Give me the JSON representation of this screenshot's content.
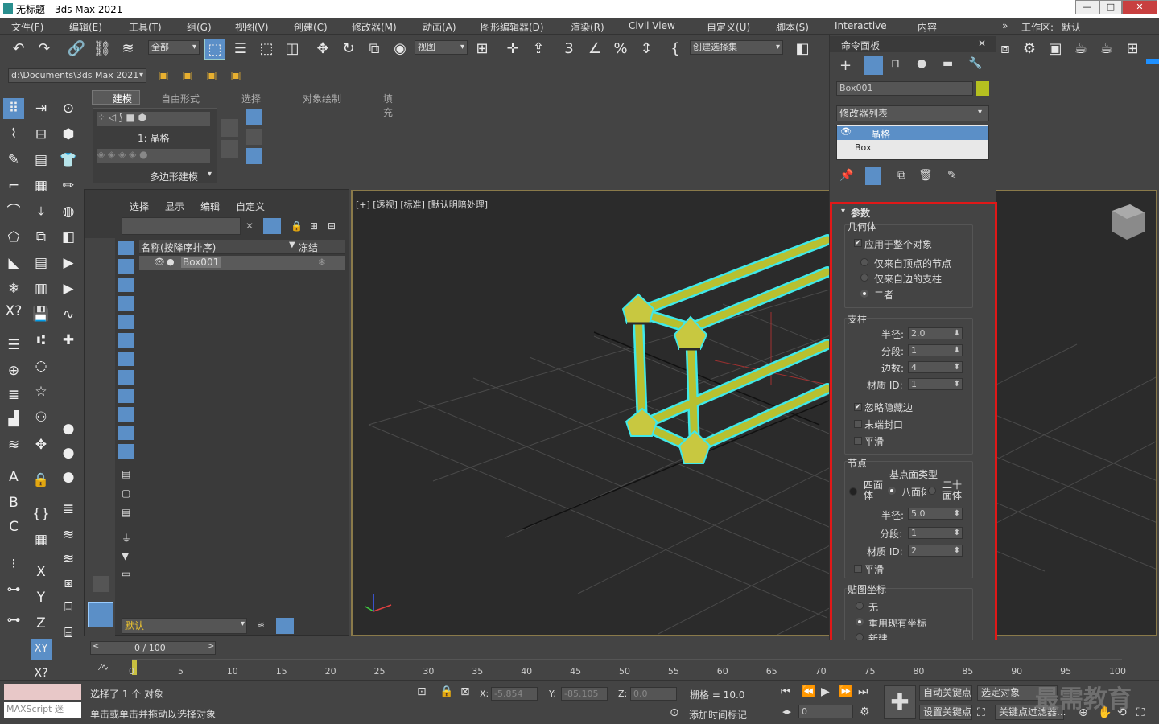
{
  "window": {
    "title": "无标题 - 3ds Max 2021",
    "min": "—",
    "max": "□",
    "close": "✕"
  },
  "menu": [
    "文件(F)",
    "编辑(E)",
    "工具(T)",
    "组(G)",
    "视图(V)",
    "创建(C)",
    "修改器(M)",
    "动画(A)",
    "图形编辑器(D)",
    "渲染(R)",
    "Civil View",
    "自定义(U)",
    "脚本(S)",
    "Interactive",
    "内容"
  ],
  "workspace": {
    "label": "工作区:",
    "value": "默认"
  },
  "toolbar": {
    "filter_dd": "全部",
    "ref_coord": "视图",
    "selection_set": "创建选择集"
  },
  "path_dd": "d:\\Documents\\3ds Max 2021",
  "ribbon": {
    "tabs": [
      "建模",
      "自由形式",
      "选择",
      "对象绘制",
      "填充"
    ],
    "sel_label": "1: 晶格",
    "panel_label": "多边形建模"
  },
  "scene": {
    "menu": [
      "选择",
      "显示",
      "编辑",
      "自定义"
    ],
    "col_name": "名称(按降序排序)",
    "col_freeze": "冻结",
    "rows": [
      {
        "name": "Box001"
      }
    ],
    "layer": "默认"
  },
  "viewport": {
    "label": "[+] [透视] [标准] [默认明暗处理]"
  },
  "cmdpanel": {
    "title": "命令面板",
    "object_name": "Box001",
    "object_color": "#b5c020",
    "modlist": "修改器列表",
    "stack": [
      "晶格",
      "Box"
    ],
    "rollout": "参数",
    "geometry": {
      "title": "几何体",
      "apply_all": "应用于整个对象",
      "opt1": "仅来自顶点的节点",
      "opt2": "仅来自边的支柱",
      "opt3": "二者"
    },
    "struts": {
      "title": "支柱",
      "radius_l": "半径:",
      "radius": "2.0",
      "seg_l": "分段:",
      "seg": "1",
      "sides_l": "边数:",
      "sides": "4",
      "mat_l": "材质 ID:",
      "mat": "1",
      "ignore": "忽略隐藏边",
      "endcaps": "末端封口",
      "smooth": "平滑"
    },
    "joints": {
      "title": "节点",
      "type_title": "基点面类型",
      "t1": "四面体",
      "t2": "八面体",
      "t3": "二十面体",
      "radius_l": "半径:",
      "radius": "5.0",
      "seg_l": "分段:",
      "seg": "1",
      "mat_l": "材质 ID:",
      "mat": "2",
      "smooth": "平滑"
    },
    "mapping": {
      "title": "贴图坐标",
      "none": "无",
      "reuse": "重用现有坐标",
      "new": "新建"
    }
  },
  "timeline": {
    "frame": "0 / 100",
    "ticks": [
      "0",
      "5",
      "10",
      "15",
      "20",
      "25",
      "30",
      "35",
      "40",
      "45",
      "50",
      "55",
      "60",
      "65",
      "70",
      "75",
      "80",
      "85",
      "90",
      "95",
      "100"
    ]
  },
  "status": {
    "maxscript": "MAXScript 迷",
    "selected": "选择了 1 个 对象",
    "prompt": "单击或单击并拖动以选择对象",
    "x_label": "X:",
    "x": "-5.854",
    "y_label": "Y:",
    "y": "-85.105",
    "z_label": "Z:",
    "z": "0.0",
    "grid": "栅格 = 10.0",
    "add_time_tag": "添加时间标记",
    "auto_key": "自动关键点",
    "sel_obj": "选定对象",
    "set_key": "设置关键点",
    "key_filter": "关键点过滤器...",
    "frame_val": "0"
  },
  "watermark": "最需教育"
}
